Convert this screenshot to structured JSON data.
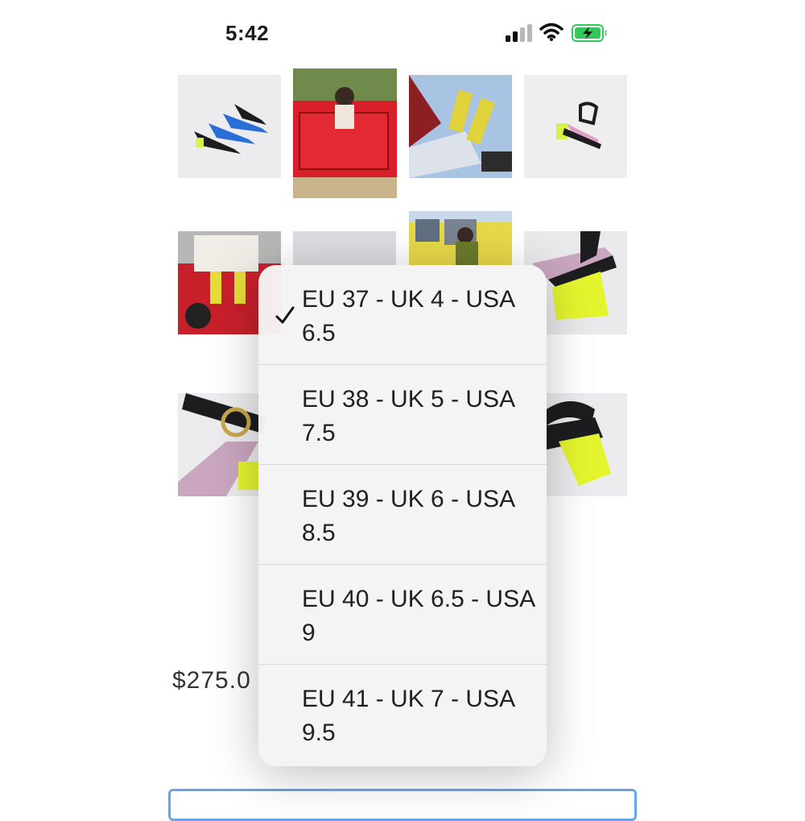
{
  "status_bar": {
    "time": "5:42",
    "icons": [
      "signal-icon",
      "wifi-icon",
      "battery-charging-icon"
    ],
    "battery_color": "#34c759"
  },
  "gallery": {
    "images": [
      "product-photo-sandals-pair",
      "lifestyle-photo-red-car",
      "lifestyle-photo-legs-in-car",
      "product-photo-single-sandal",
      "lifestyle-photo-red-car-hood",
      "product-photo-placeholder",
      "lifestyle-photo-yellow-car",
      "product-photo-heel-closeup",
      "product-photo-buckle-closeup",
      "product-photo-heel-side"
    ]
  },
  "size_dropdown": {
    "selected_index": 0,
    "options": [
      {
        "label": "EU 37 - UK 4 - USA 6.5"
      },
      {
        "label": "EU 38 - UK 5 - USA 7.5"
      },
      {
        "label": "EU 39 - UK 6 - USA 8.5"
      },
      {
        "label": "EU 40 - UK 6.5 - USA 9"
      },
      {
        "label": "EU 41 - UK 7 - USA 9.5"
      }
    ]
  },
  "product": {
    "price": "$275.0"
  },
  "colors": {
    "accent_yellow": "#e6f52a",
    "field_border": "#6aa3e8"
  }
}
